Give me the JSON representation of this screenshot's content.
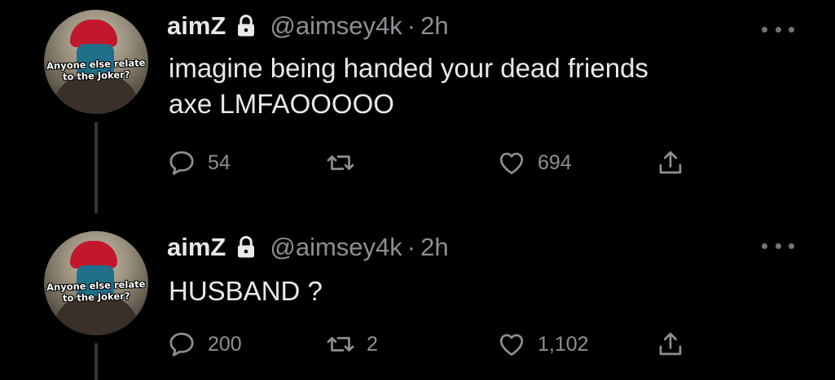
{
  "tweets": [
    {
      "display_name": "aimZ",
      "handle": "@aimsey4k",
      "separator": "·",
      "time": "2h",
      "avatar_caption": "Anyone else relate to the Joker?",
      "text_lines": [
        "imagine being handed your dead friends",
        "axe LMFAOOOOO"
      ],
      "replies": "54",
      "retweets": "",
      "likes": "694"
    },
    {
      "display_name": "aimZ",
      "handle": "@aimsey4k",
      "separator": "·",
      "time": "2h",
      "avatar_caption": "Anyone else relate to the Joker?",
      "text_lines": [
        "HUSBAND ?"
      ],
      "replies": "200",
      "retweets": "2",
      "likes": "1,102"
    }
  ],
  "icons": {
    "lock": "lock-icon",
    "more": "more-icon",
    "reply": "reply-icon",
    "retweet": "retweet-icon",
    "like": "heart-icon",
    "share": "share-icon"
  },
  "colors": {
    "background": "#000000",
    "primary_text": "#e7e9ea",
    "secondary_text": "#8b9095",
    "thread_line": "#333639"
  }
}
